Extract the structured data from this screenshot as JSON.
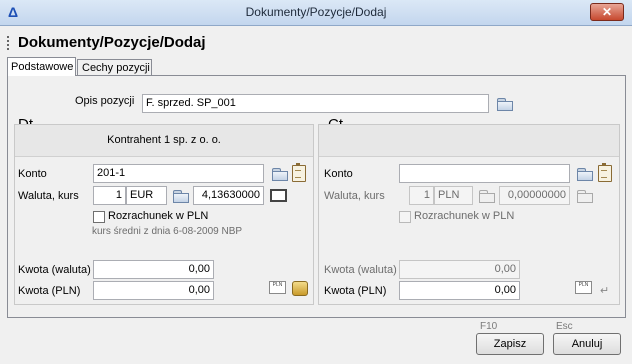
{
  "window": {
    "title": "Dokumenty/Pozycje/Dodaj",
    "close": "✕"
  },
  "page": {
    "title": "Dokumenty/Pozycje/Dodaj"
  },
  "tabs": [
    {
      "label": "Podstawowe"
    },
    {
      "label": "Cechy pozycji"
    }
  ],
  "description": {
    "label": "Opis pozycji",
    "value": "F. sprzed. SP_001"
  },
  "dt": {
    "header": "Dt",
    "contractor": "Kontrahent 1 sp. z o. o.",
    "account": {
      "label": "Konto",
      "value": "201-1"
    },
    "currency": {
      "label": "Waluta, kurs",
      "number": "1",
      "code": "EUR",
      "rate": "4,13630000"
    },
    "settlement": {
      "label": "Rozrachunek w PLN"
    },
    "rate_note": "kurs średni z dnia  6-08-2009 NBP",
    "amount_currency": {
      "label": "Kwota (waluta)",
      "value": "0,00"
    },
    "amount_pln": {
      "label": "Kwota (PLN)",
      "value": "0,00"
    }
  },
  "ct": {
    "header": "Ct",
    "account": {
      "label": "Konto",
      "value": ""
    },
    "currency": {
      "label": "Waluta, kurs",
      "number": "1",
      "code": "PLN",
      "rate": "0,00000000"
    },
    "settlement": {
      "label": "Rozrachunek w PLN"
    },
    "amount_currency": {
      "label": "Kwota (waluta)",
      "value": "0,00"
    },
    "amount_pln": {
      "label": "Kwota (PLN)",
      "value": "0,00"
    }
  },
  "footer": {
    "save": {
      "key": "F10",
      "label": "Zapisz"
    },
    "cancel": {
      "key": "Esc",
      "label": "Anuluj"
    }
  },
  "icons": {
    "calc_text": "PLN"
  }
}
